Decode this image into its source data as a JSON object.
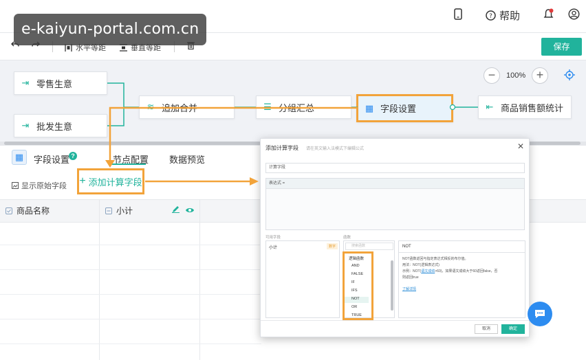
{
  "watermark": "e-kaiyun-portal.com.cn",
  "header": {
    "phone_icon": "mobile-icon",
    "help_label": "帮助",
    "bell_icon": "bell-icon",
    "user_icon": "user-icon"
  },
  "toolbar": {
    "undo_icon": "undo-icon",
    "redo_icon": "redo-icon",
    "h_spacing": "水平等距",
    "v_spacing": "垂直等距",
    "delete_icon": "trash-icon",
    "save_label": "保存"
  },
  "canvas": {
    "zoom_level": "100%",
    "nodes": {
      "retail": "零售生意",
      "wholesale": "批发生意",
      "append_merge": "追加合并",
      "group_summary": "分组汇总",
      "field_settings": "字段设置",
      "output": "商品销售额统计"
    }
  },
  "panel": {
    "title": "字段设置",
    "tabs": [
      "节点配置",
      "数据预览"
    ],
    "show_original": "显示原始字段",
    "add_calc_field": "添加计算字段",
    "columns": [
      "商品名称",
      "小计"
    ]
  },
  "dialog": {
    "title": "添加计算字段",
    "hint": "请在英文输入法模式下编辑公式",
    "name_value": "计算字段",
    "expr_label": "表达式 =",
    "fields_label": "可用字段",
    "functions_label": "函数",
    "field_item": "小计",
    "field_type": "数字",
    "search_placeholder": "搜索函数",
    "function_group": "逻辑函数",
    "functions": [
      "AND",
      "FALSE",
      "IF",
      "IFS",
      "NOT",
      "OR",
      "TRUE"
    ],
    "selected_function": "NOT",
    "doc_title": "NOT",
    "doc_desc": "NOT函数返回与指定表达式相反的布尔值。",
    "doc_usage": "用法：NOT(逻辑表达式)",
    "doc_example_a": "示例：NOT(",
    "doc_example_field": "语文成绩",
    "doc_example_b": ">60)，如果语文成绩大于60返回false，否",
    "doc_example_c": "则返回true",
    "doc_link": "了解详情",
    "cancel_label": "取消",
    "ok_label": "确定"
  },
  "colors": {
    "accent": "#21b39c",
    "highlight": "#f2a33a",
    "fab": "#2d8cf0"
  }
}
